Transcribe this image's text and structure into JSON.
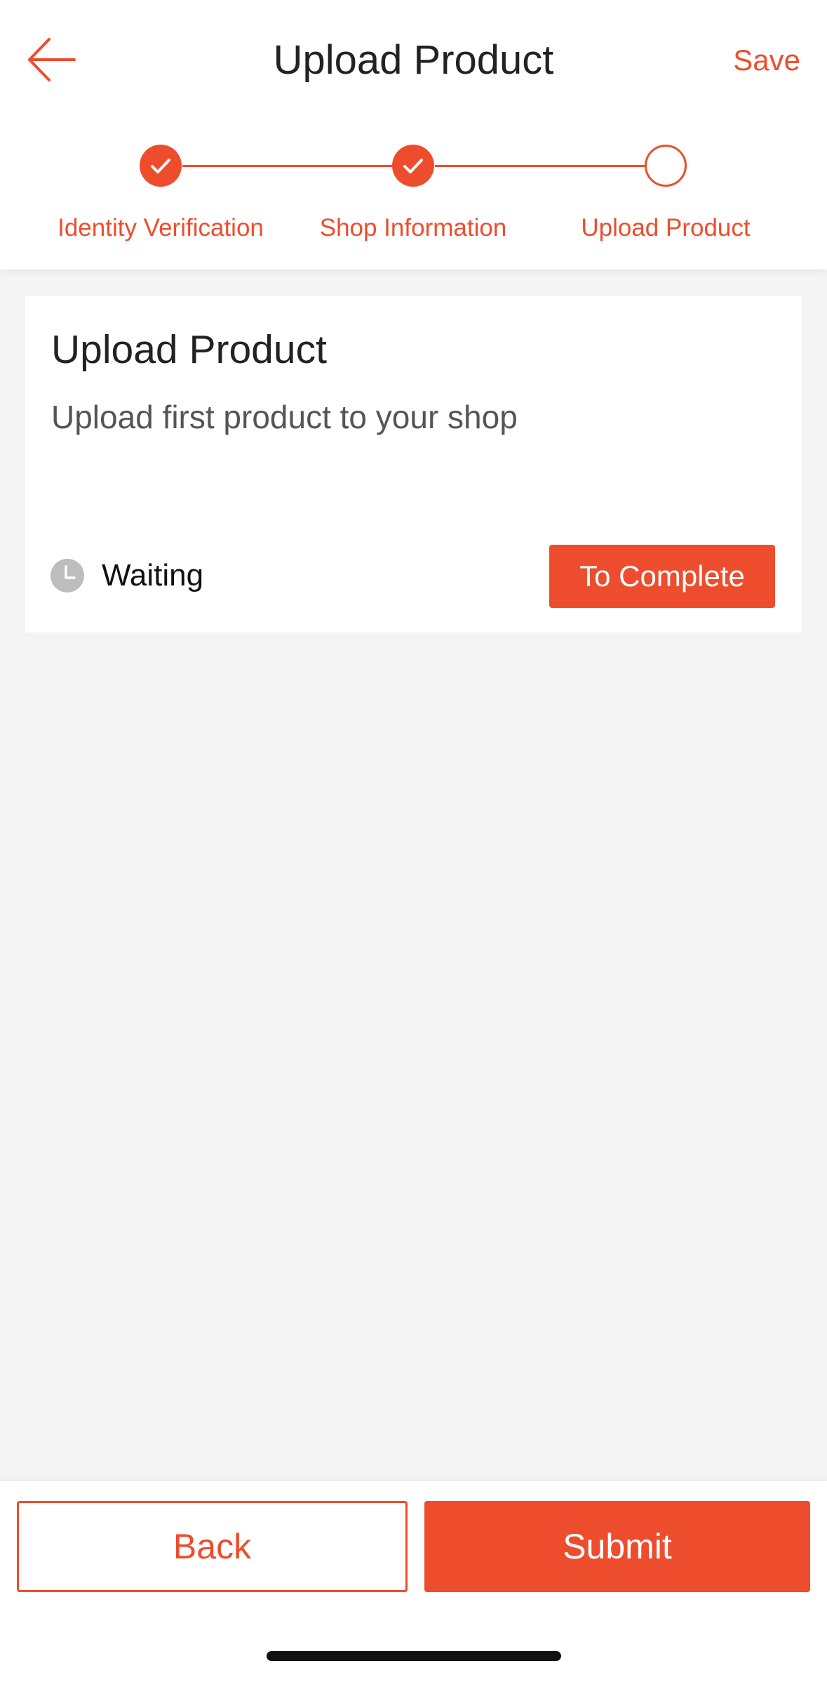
{
  "header": {
    "title": "Upload Product",
    "save_label": "Save",
    "back_icon": "arrow-left-icon"
  },
  "steps": [
    {
      "label": "Identity Verification",
      "state": "done"
    },
    {
      "label": "Shop Information",
      "state": "done"
    },
    {
      "label": "Upload Product",
      "state": "current"
    }
  ],
  "card": {
    "title": "Upload Product",
    "description": "Upload first product to your shop",
    "status": "Waiting",
    "status_icon": "clock-icon",
    "action_label": "To Complete"
  },
  "footer": {
    "back_label": "Back",
    "submit_label": "Submit"
  },
  "colors": {
    "accent": "#ee4d2d",
    "background": "#f4f4f4",
    "status_icon": "#bdbdbd"
  }
}
